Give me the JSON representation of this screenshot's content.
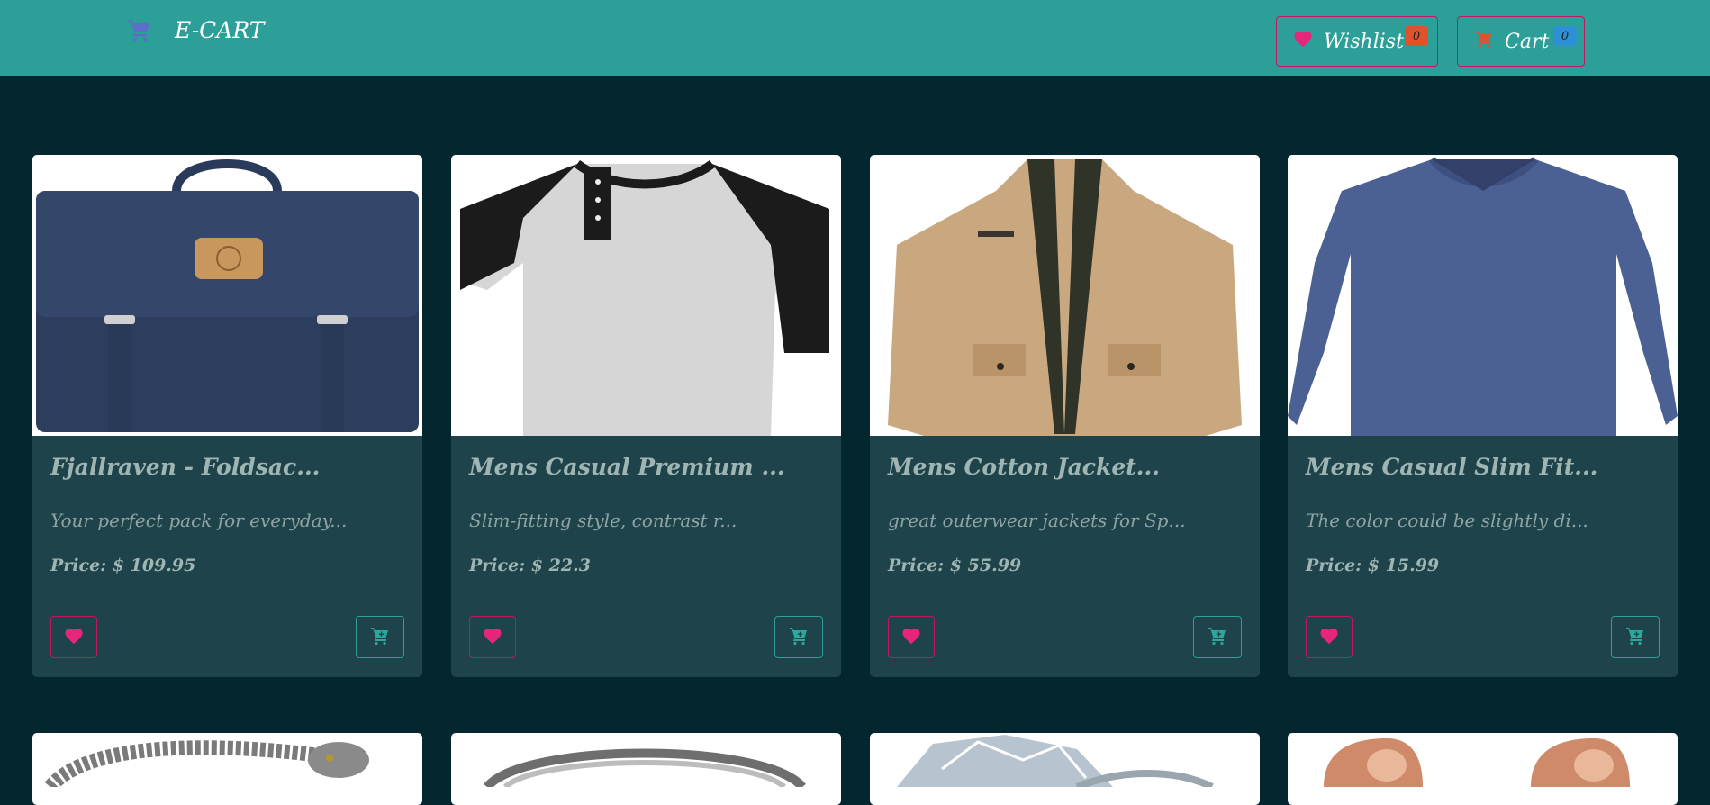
{
  "navbar": {
    "brand": "E-CART",
    "wishlist_label": "Wishlist",
    "wishlist_count": "0",
    "cart_label": "Cart",
    "cart_count": "0"
  },
  "products": [
    {
      "title": "Fjallraven - Foldsac...",
      "description": "Your perfect pack for everyday...",
      "price": "Price: $ 109.95",
      "image": "navy backpack"
    },
    {
      "title": "Mens Casual Premium ...",
      "description": "Slim-fitting style, contrast r...",
      "price": "Price: $ 22.3",
      "image": "raglan henley shirt"
    },
    {
      "title": "Mens Cotton Jacket...",
      "description": "great outerwear jackets for Sp...",
      "price": "Price: $ 55.99",
      "image": "khaki cotton jacket"
    },
    {
      "title": "Mens Casual Slim Fit...",
      "description": "The color could be slightly di...",
      "price": "Price: $ 15.99",
      "image": "blue long sleeve tee"
    }
  ],
  "next_row_images": [
    "silver dragon bracelet",
    "silver ring",
    "crystal ring",
    "rose gold earrings"
  ],
  "colors": {
    "navbar": "#2c9f98",
    "background": "#03262f",
    "card": "#1e434a",
    "wishlist_accent": "#c2185b",
    "cart_accent": "#2c9f98",
    "wishlist_badge": "#e0522a",
    "cart_badge": "#2d8fd6"
  },
  "icons": {
    "brand": "shopping-cart-icon",
    "wishlist": "heart-icon",
    "cart": "shopping-cart-icon",
    "card_wishlist": "heart-icon",
    "card_cart": "cart-plus-icon"
  }
}
